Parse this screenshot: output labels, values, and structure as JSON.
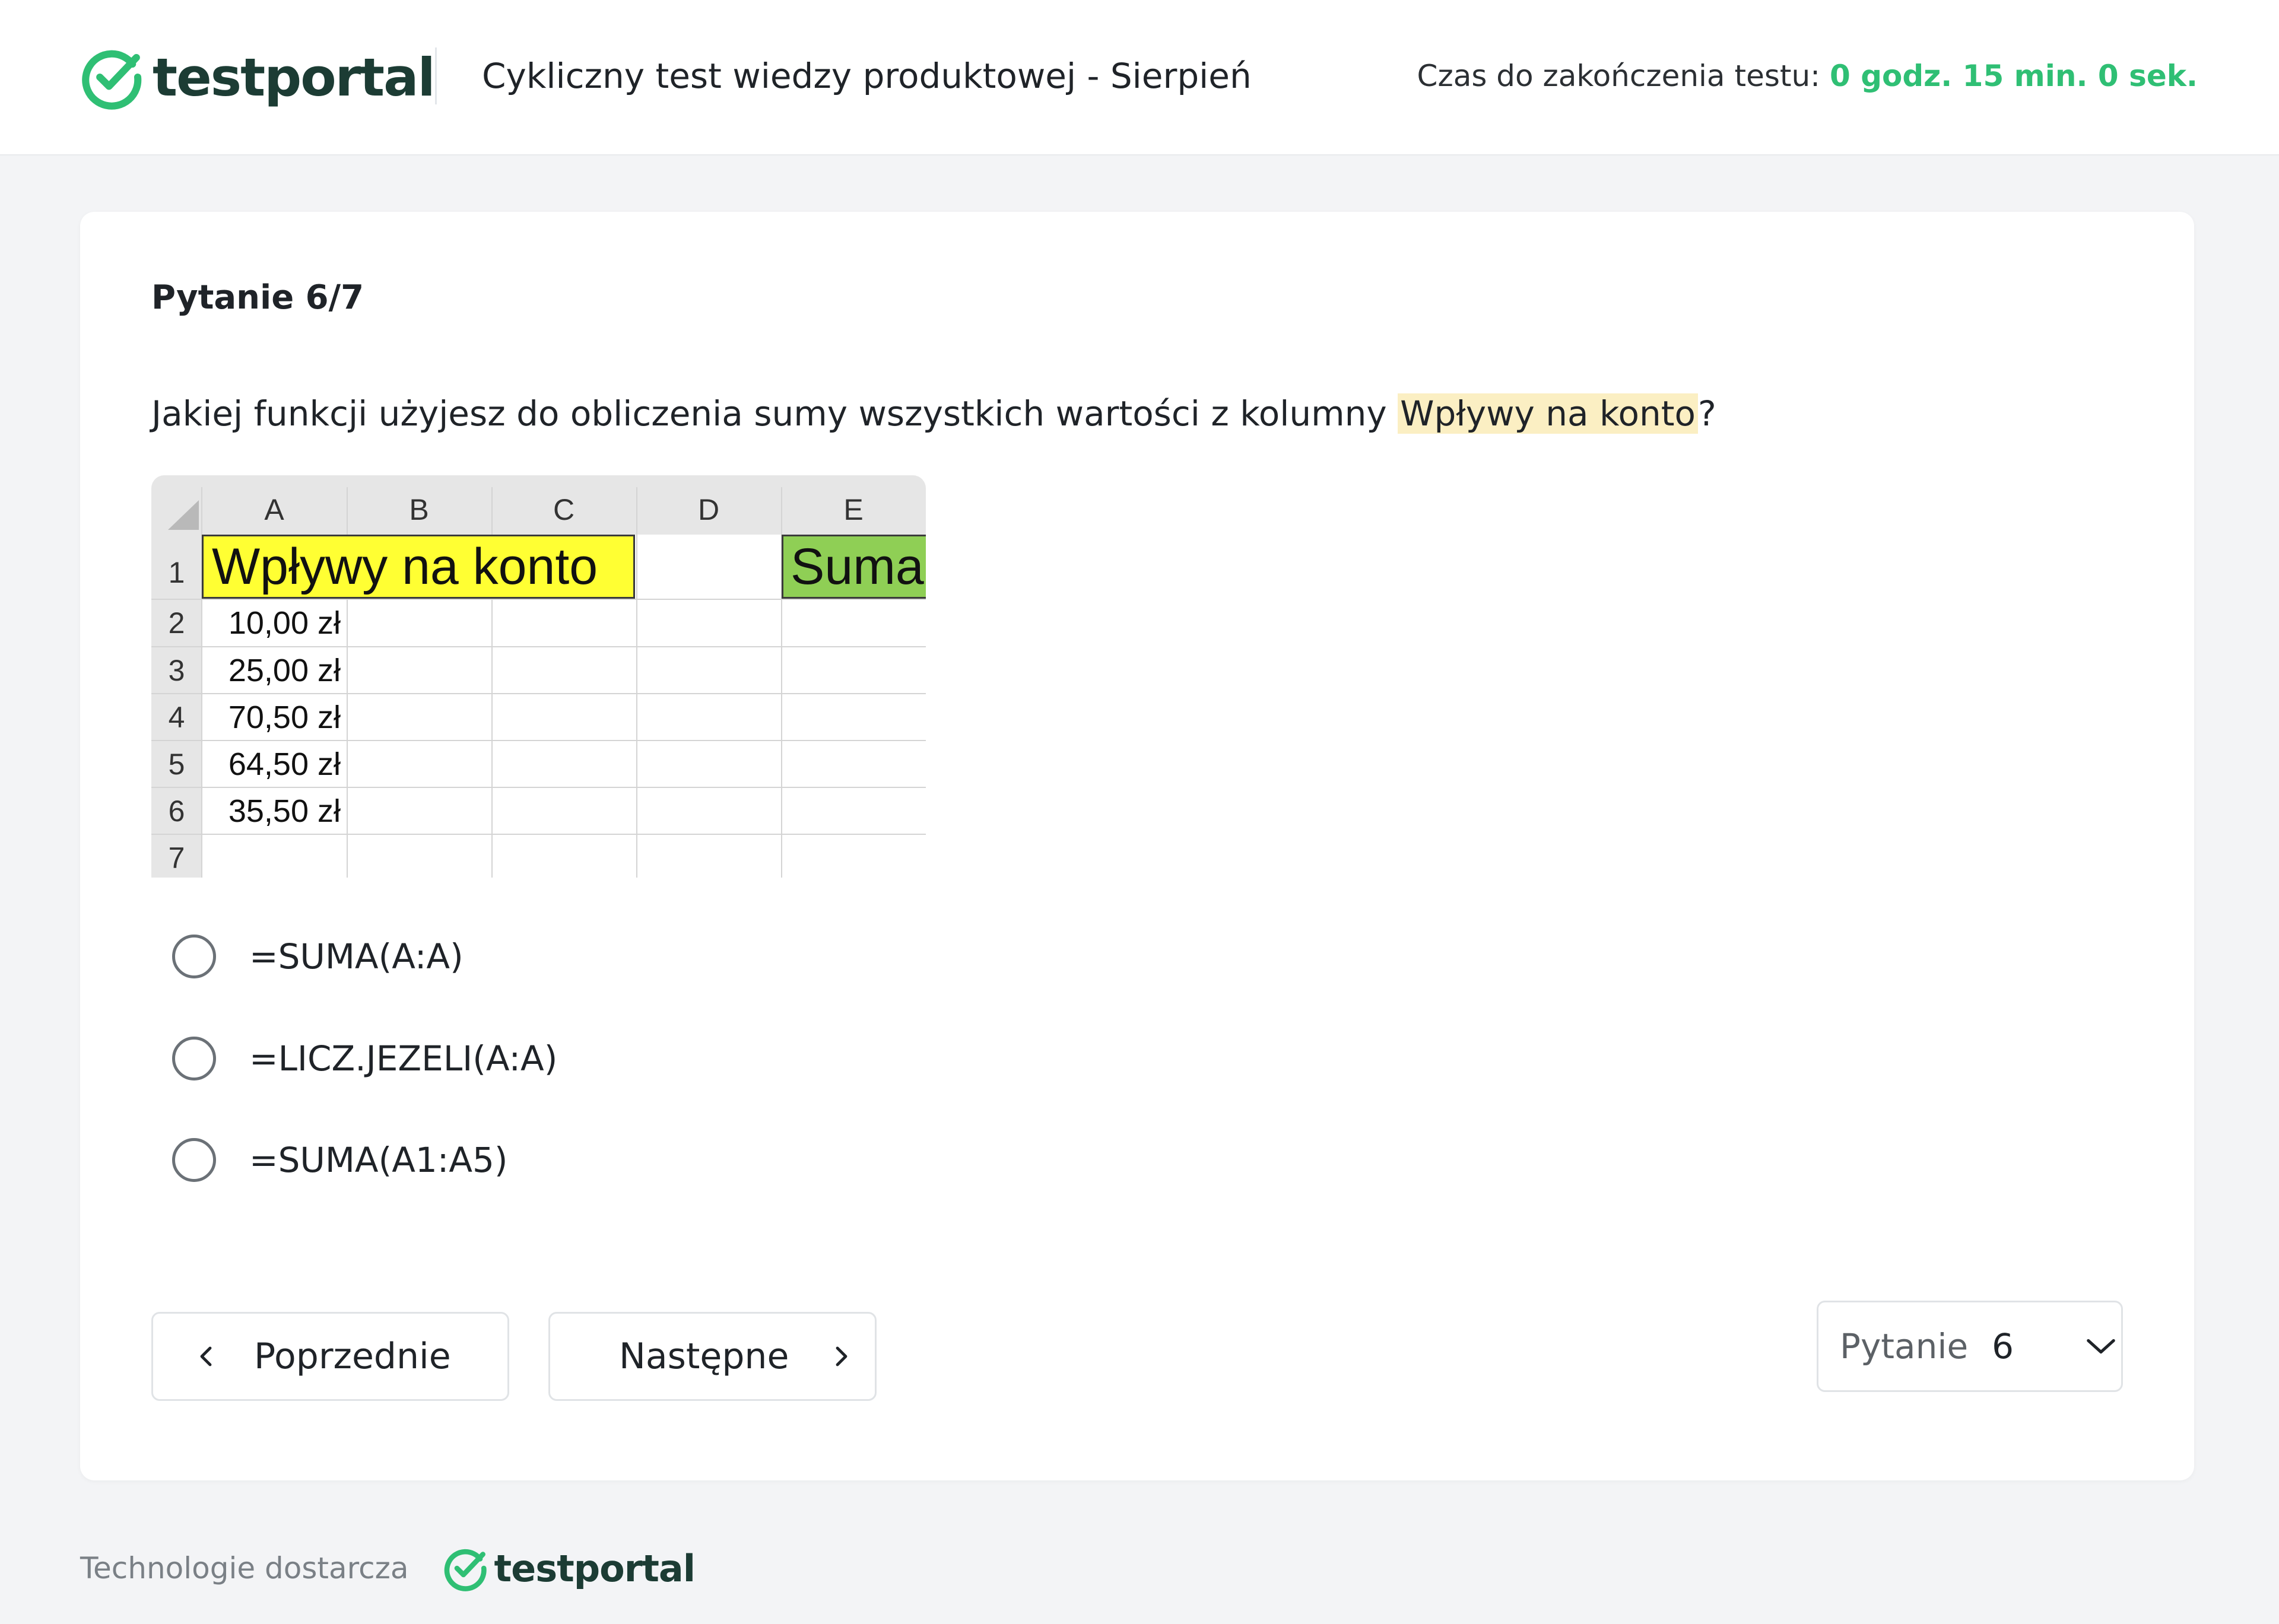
{
  "header": {
    "brand": "testportal",
    "test_title": "Cykliczny test wiedzy produktowej - Sierpień",
    "timer_label": "Czas do zakończenia testu:",
    "timer_value": "0 godz. 15 min. 0 sek."
  },
  "question": {
    "counter": "Pytanie 6/7",
    "text_before": "Jakiej funkcji użyjesz do obliczenia sumy wszystkich wartości z kolumny ",
    "text_highlight": "Wpływy na konto",
    "text_after": "?"
  },
  "spreadsheet": {
    "columns": [
      "A",
      "B",
      "C",
      "D",
      "E"
    ],
    "rows": [
      "1",
      "2",
      "3",
      "4",
      "5",
      "6",
      "7"
    ],
    "header_cell": "Wpływy na konto",
    "sum_cell": "Suma",
    "values": [
      "10,00 zł",
      "25,00 zł",
      "70,50 zł",
      "64,50 zł",
      "35,50 zł"
    ],
    "colors": {
      "header_fill": "#ffff33",
      "sum_fill": "#8fcf55"
    }
  },
  "answers": [
    {
      "label": "=SUMA(A:A)",
      "selected": false
    },
    {
      "label": "=LICZ.JEZELI(A:A)",
      "selected": false
    },
    {
      "label": "=SUMA(A1:A5)",
      "selected": false
    }
  ],
  "navigation": {
    "prev_label": "Poprzednie",
    "next_label": "Następne",
    "select_label": "Pytanie",
    "select_value": "6"
  },
  "footer": {
    "text": "Technologie dostarcza",
    "brand": "testportal"
  },
  "theme": {
    "accent": "#2fbf74",
    "brand_dark": "#1c3c34",
    "highlight": "#fbefc3"
  },
  "icons": [
    "check-circle-logo-icon",
    "chevron-left-icon",
    "chevron-right-icon",
    "chevron-down-icon",
    "radio-icon",
    "select-all-corner-icon"
  ]
}
